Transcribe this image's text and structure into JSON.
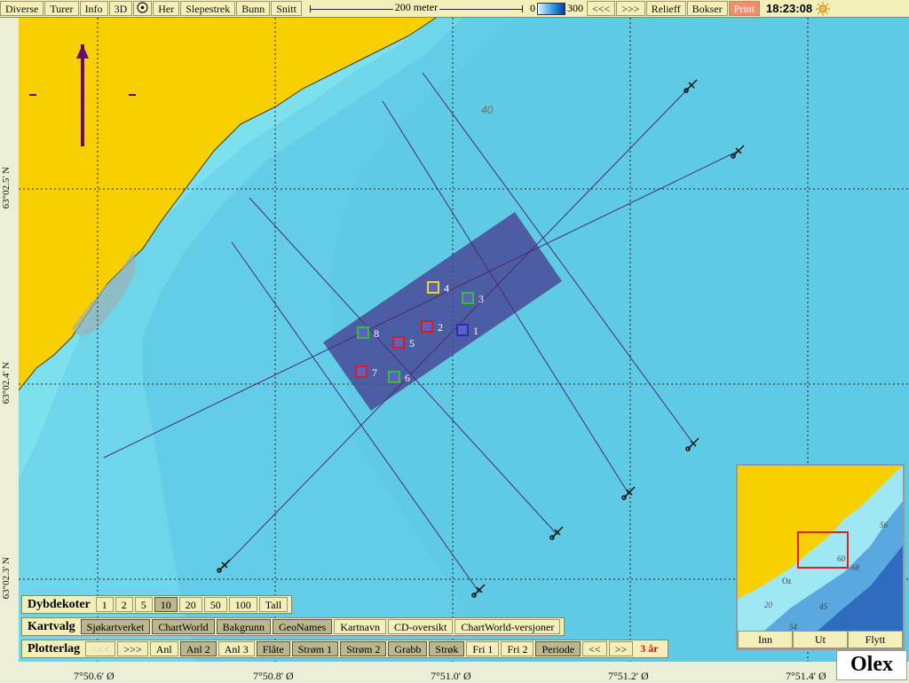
{
  "toolbar": {
    "buttons": [
      "Diverse",
      "Turer",
      "Info",
      "3D",
      "Her",
      "Slepestrek",
      "Bunn",
      "Snitt"
    ],
    "scale_label": "200 meter",
    "depth_min": "0",
    "depth_max": "300",
    "prev": "<<<",
    "next": ">>>",
    "relief": "Relieff",
    "bokser": "Bokser",
    "print": "Print",
    "time": "18:23:08"
  },
  "map": {
    "depth_label": "40",
    "lat_labels": [
      "63°02.5' N",
      "63°02.4' N",
      "63°02.3' N"
    ],
    "lon_labels": [
      "7°50.6' Ø",
      "7°50.8' Ø",
      "7°51.0' Ø",
      "7°51.2' Ø",
      "7°51.4' Ø"
    ],
    "markers": [
      {
        "label": "1",
        "color": "#2030c0"
      },
      {
        "label": "2",
        "color": "#d02020"
      },
      {
        "label": "3",
        "color": "#30c030"
      },
      {
        "label": "4",
        "color": "#e8d820"
      },
      {
        "label": "5",
        "color": "#d02020"
      },
      {
        "label": "6",
        "color": "#30c030"
      },
      {
        "label": "7",
        "color": "#d02020"
      },
      {
        "label": "8",
        "color": "#30c030"
      }
    ]
  },
  "panels": {
    "dybdekoter": {
      "title": "Dybdekoter",
      "buttons": [
        "1",
        "2",
        "5",
        "10",
        "20",
        "50",
        "100",
        "Tall"
      ],
      "selected": "10"
    },
    "kartvalg": {
      "title": "Kartvalg",
      "buttons": [
        "Sjøkartverket",
        "ChartWorld",
        "Bakgrunn",
        "GeoNames",
        "Kartnavn",
        "CD-oversikt",
        "ChartWorld-versjoner"
      ]
    },
    "plotterlag": {
      "title": "Plotterlag",
      "buttons": [
        "<<<",
        ">>>",
        "Anl",
        "Anl 2",
        "Anl 3",
        "Flåte",
        "Strøm 1",
        "Strøm 2",
        "Grabb",
        "Strøk",
        "Fri 1",
        "Fri 2",
        "Periode",
        "<<",
        ">>"
      ],
      "period": "3 år"
    }
  },
  "minimap": {
    "labels": [
      "Oz",
      "20",
      "45",
      "60",
      "68",
      "54",
      "56"
    ],
    "buttons": [
      "Inn",
      "Ut",
      "Flytt"
    ]
  },
  "logo": "Olex"
}
